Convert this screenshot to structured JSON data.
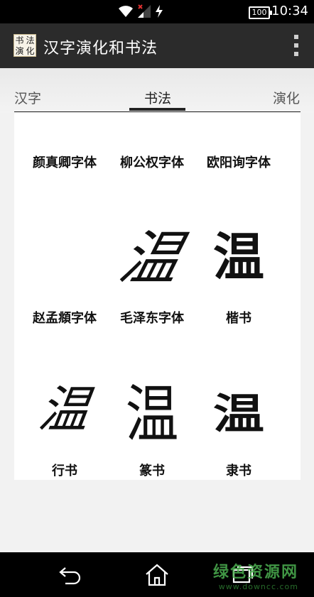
{
  "status_bar": {
    "time": "10:34",
    "battery": "100"
  },
  "action_bar": {
    "icon_chars": [
      "书",
      "法",
      "演",
      "化"
    ],
    "title": "汉字演化和书法"
  },
  "tabs": [
    {
      "label": "汉字"
    },
    {
      "label": "书法",
      "selected": true
    },
    {
      "label": "演化"
    }
  ],
  "grid": {
    "items": [
      {
        "label": "颜真卿字体",
        "glyph": ""
      },
      {
        "label": "柳公权字体",
        "glyph": ""
      },
      {
        "label": "欧阳询字体",
        "glyph": ""
      },
      {
        "label": "赵孟頫字体",
        "glyph": ""
      },
      {
        "label": "毛泽东字体",
        "glyph": "温"
      },
      {
        "label": "楷书",
        "glyph": "温"
      },
      {
        "label": "行书",
        "glyph": "温"
      },
      {
        "label": "篆书",
        "glyph": "温"
      },
      {
        "label": "隶书",
        "glyph": "温"
      }
    ]
  },
  "watermark": {
    "main": "绿色资源网",
    "sub": "www.downcc.com"
  },
  "colors": {
    "action_bar": "#2b2b2b",
    "status_bar": "#000000",
    "watermark": "#4caf50"
  }
}
